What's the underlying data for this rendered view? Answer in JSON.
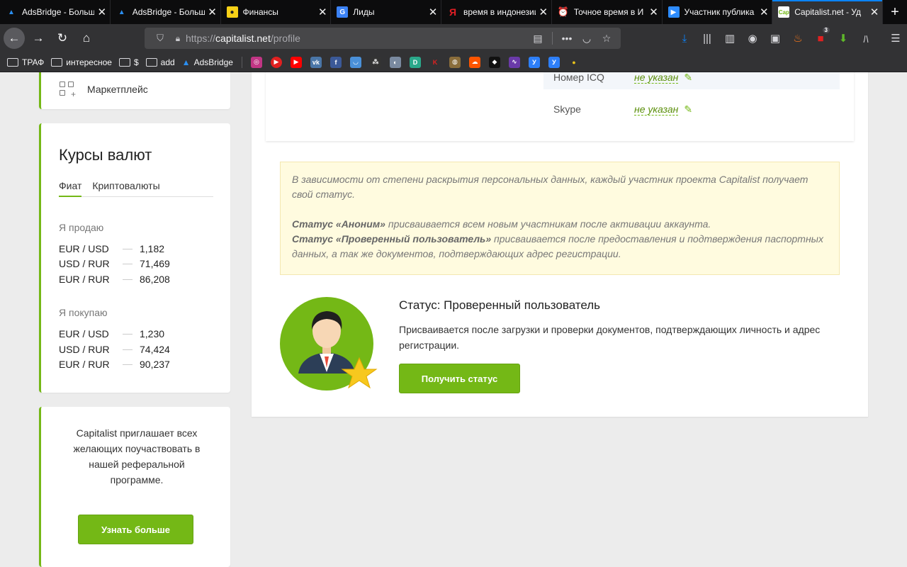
{
  "browser": {
    "tabs": [
      {
        "title": "AdsBridge - Больш",
        "favicon_color": "#2a8ef0",
        "active": false
      },
      {
        "title": "AdsBridge - Больш",
        "favicon_color": "#2a8ef0",
        "active": false
      },
      {
        "title": "Финансы",
        "favicon_color": "#f7d117",
        "active": false
      },
      {
        "title": "Лиды",
        "favicon_color": "#3b82f6",
        "active": false
      },
      {
        "title": "время в индонезии",
        "favicon_color": "#e31e24",
        "active": false
      },
      {
        "title": "Точное время в И",
        "favicon_color": "#e02020",
        "active": false
      },
      {
        "title": "Участник публика",
        "favicon_color": "#2d8cff",
        "active": false
      },
      {
        "title": "Capitalist.net - Уд",
        "favicon_color": "#74b816",
        "active": true
      }
    ],
    "url": {
      "scheme": "https://",
      "host": "capitalist.net",
      "path": "/profile"
    },
    "bookmarks": {
      "folders": [
        "ТРАФ",
        "интересное",
        "$",
        "add"
      ],
      "link": "AdsBridge"
    },
    "toolbar_badge": "3"
  },
  "sidebar": {
    "marketplace_label": "Маркетплейс",
    "rates": {
      "title": "Курсы валют",
      "tab_fiat": "Фиат",
      "tab_crypto": "Криптовалюты",
      "sell_label": "Я продаю",
      "sell_rows": [
        {
          "pair": "EUR / USD",
          "value": "1,182"
        },
        {
          "pair": "USD / RUR",
          "value": "71,469"
        },
        {
          "pair": "EUR / RUR",
          "value": "86,208"
        }
      ],
      "buy_label": "Я покупаю",
      "buy_rows": [
        {
          "pair": "EUR / USD",
          "value": "1,230"
        },
        {
          "pair": "USD / RUR",
          "value": "74,424"
        },
        {
          "pair": "EUR / RUR",
          "value": "90,237"
        }
      ]
    },
    "referral": {
      "text": "Capitalist приглашает всех желающих поучаствовать в нашей реферальной программе.",
      "button": "Узнать больше"
    }
  },
  "profile": {
    "rows": [
      {
        "key": "Номер ICQ",
        "value": "не указан"
      },
      {
        "key": "Skype",
        "value": "не указан"
      }
    ]
  },
  "notice": {
    "intro": "В зависимости от степени раскрытия персональных данных, каждый участник проекта Capitalist получает свой статус.",
    "anon_bold": "Статус «Аноним»",
    "anon_text": " присваивается всем новым участникам после активации аккаунта.",
    "verified_bold": "Статус «Проверенный пользователь»",
    "verified_text": " присваивается после предоставления и подтверждения паспортных данных, а так же документов, подтверждающих адрес регистрации."
  },
  "status": {
    "title": "Статус: Проверенный пользователь",
    "description": "Присваивается после загрузки и проверки документов, подтверждающих личность и адрес регистрации.",
    "button": "Получить статус"
  }
}
